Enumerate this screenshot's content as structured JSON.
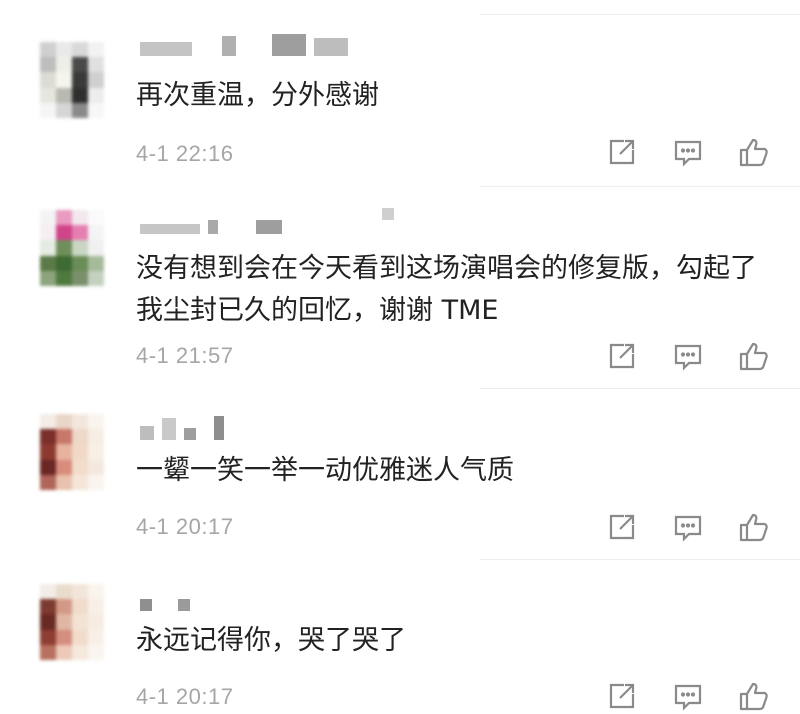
{
  "comments": [
    {
      "text": "再次重温，分外感谢",
      "time": "4-1 22:16"
    },
    {
      "text": "没有想到会在今天看到这场演唱会的修复版，勾起了我尘封已久的回忆，谢谢 TME",
      "time": "4-1 21:57"
    },
    {
      "text": "一颦一笑一举一动优雅迷人气质",
      "time": "4-1 20:17"
    },
    {
      "text": "永远记得你，哭了哭了",
      "time": "4-1 20:17"
    }
  ],
  "icons": {
    "share": "share-icon",
    "reply": "comment-icon",
    "like": "thumbs-up-icon"
  },
  "colors": {
    "text": "#222222",
    "time": "#a6a6a6",
    "icon": "#8a8a8a"
  }
}
